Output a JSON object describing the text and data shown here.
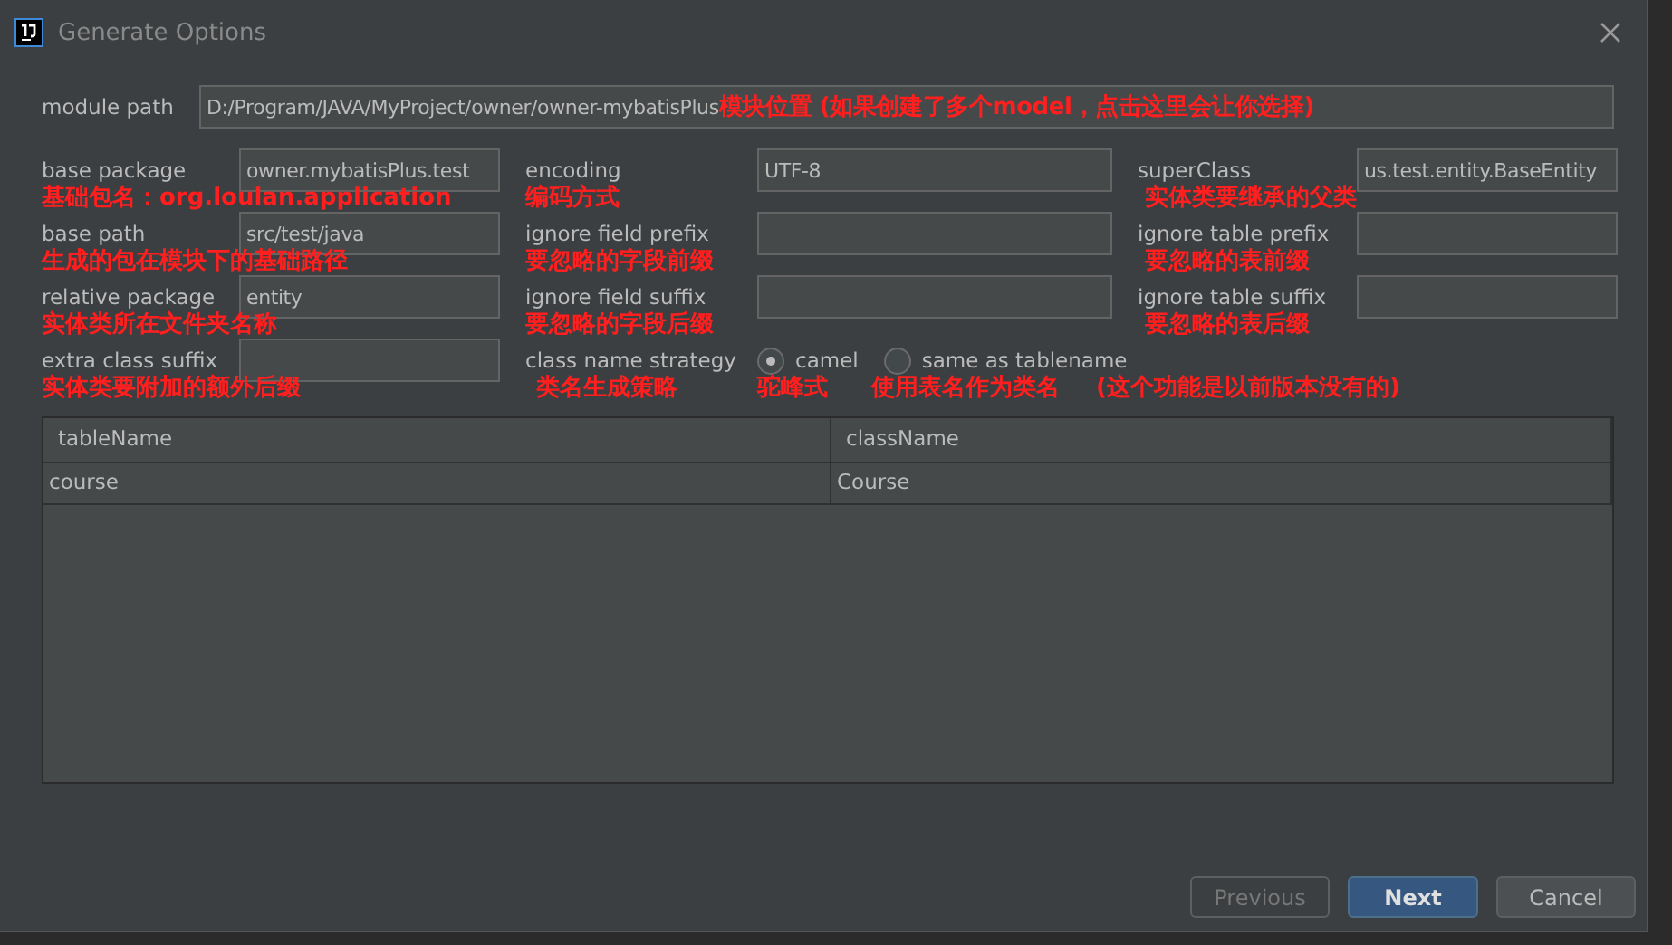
{
  "window": {
    "title": "Generate Options"
  },
  "module_path": {
    "label": "module path",
    "value": "D:/Program/JAVA/MyProject/owner/owner-mybatisPlus",
    "note": "模块位置 (如果创建了多个model，点击这里会让你选择)"
  },
  "rows": [
    [
      {
        "label": "base package",
        "value": "owner.mybatisPlus.test",
        "note": "基础包名：org.loulan.application"
      },
      {
        "label": "encoding",
        "value": "UTF-8",
        "note": "编码方式"
      },
      {
        "label": "superClass",
        "value": "us.test.entity.BaseEntity",
        "note": "实体类要继承的父类"
      }
    ],
    [
      {
        "label": "base path",
        "value": "src/test/java",
        "note": "生成的包在模块下的基础路径"
      },
      {
        "label": "ignore field prefix",
        "note": "要忽略的字段前缀"
      },
      {
        "label": "ignore table prefix",
        "note": "要忽略的表前缀"
      }
    ],
    [
      {
        "label": "relative package",
        "value": "entity",
        "note": "实体类所在文件夹名称"
      },
      {
        "label": "ignore field suffix",
        "note": "要忽略的字段后缀"
      },
      {
        "label": "ignore table suffix",
        "note": "要忽略的表后缀"
      }
    ]
  ],
  "extra_suffix": {
    "label": "extra class suffix",
    "note": "实体类要附加的额外后缀"
  },
  "strategy": {
    "label": "class name strategy",
    "note": "类名生成策略",
    "options": [
      {
        "label": "camel",
        "selected": true,
        "note": "驼峰式"
      },
      {
        "label": "same as tablename",
        "selected": false,
        "note": "使用表名作为类名"
      }
    ],
    "extra_note": "(这个功能是以前版本没有的)"
  },
  "table": {
    "columns": [
      "tableName",
      "className"
    ],
    "rows": [
      [
        "course",
        "Course"
      ]
    ]
  },
  "buttons": [
    {
      "label": "Previous",
      "kind": "secondary",
      "disabled": true
    },
    {
      "label": "Next",
      "kind": "primary",
      "disabled": false
    },
    {
      "label": "Cancel",
      "kind": "secondary",
      "disabled": false
    }
  ]
}
